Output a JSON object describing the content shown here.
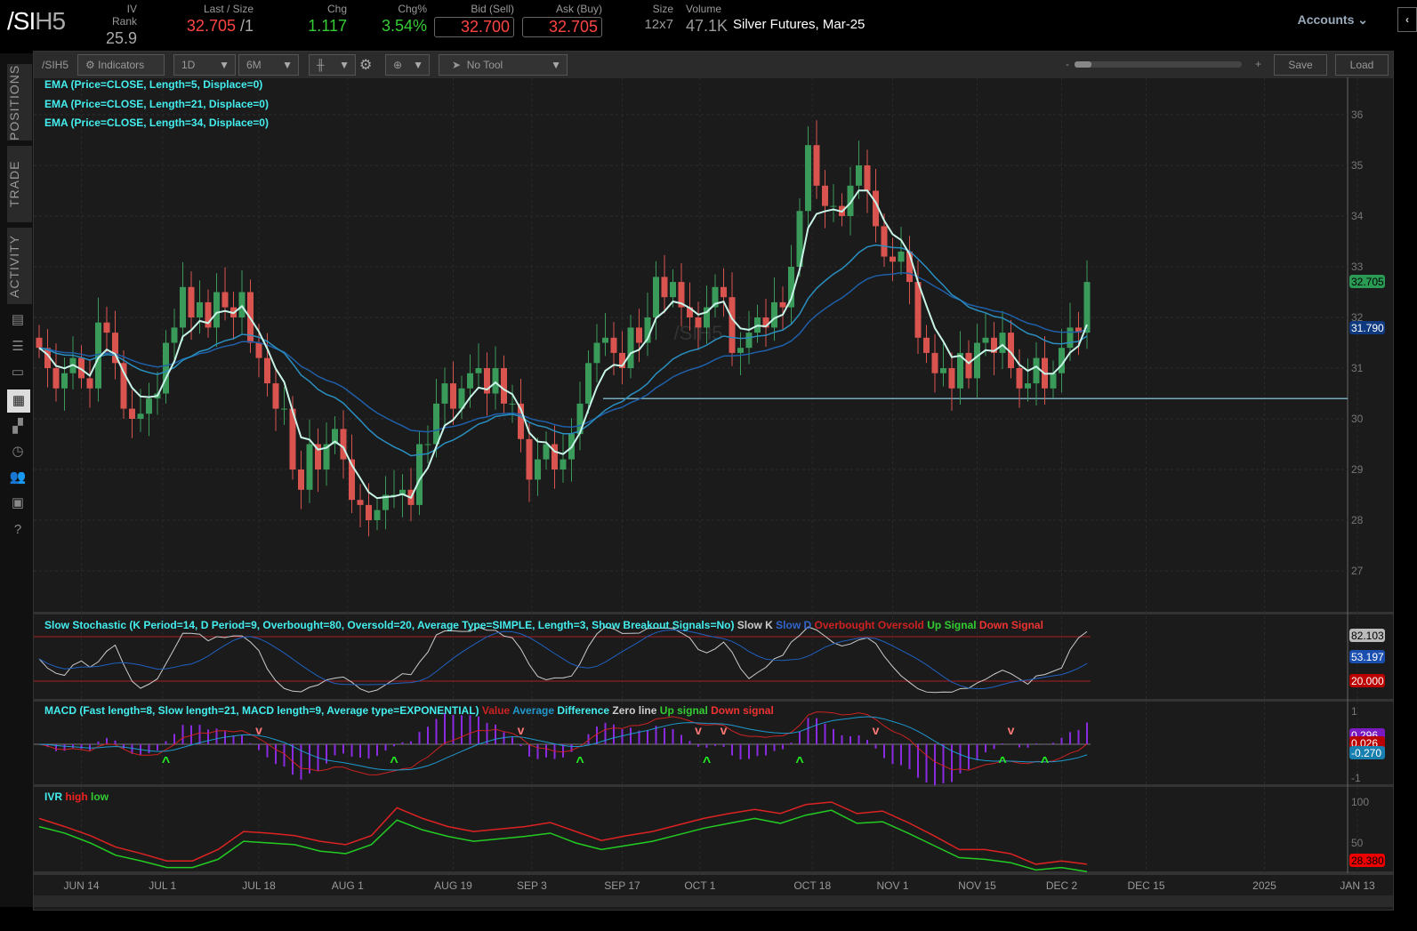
{
  "header": {
    "symbol_root": "/SI",
    "symbol_suffix": "H5",
    "quotes": [
      {
        "label": "IV Rank",
        "value": "25.9"
      },
      {
        "label": "Last / Size",
        "value": "32.705",
        "size": " /1"
      },
      {
        "label": "Chg",
        "value": "1.117"
      },
      {
        "label": "Chg%",
        "value": "3.54%"
      },
      {
        "label": "Bid (Sell)",
        "value": "32.700"
      },
      {
        "label": "Ask (Buy)",
        "value": "32.705"
      },
      {
        "label": "Size",
        "value": "12x7"
      },
      {
        "label": "Volume",
        "value": "47.1K"
      }
    ],
    "description": "Silver Futures, Mar-25",
    "accounts": "Accounts"
  },
  "sidebar": {
    "tabs": [
      "POSITIONS",
      "TRADE",
      "ACTIVITY"
    ],
    "icons": [
      "chart-report-icon",
      "list-icon",
      "tv-icon",
      "charts-icon",
      "grid-icon",
      "clock-icon",
      "community-icon",
      "calendar-icon",
      "help-icon"
    ]
  },
  "toolbar": {
    "symbol": "/SIH5",
    "indicators": "Indicators",
    "aggregation": "1D",
    "timeframe": "6M",
    "tool": "No Tool",
    "zoom_minus": "-",
    "zoom_plus": "+",
    "save": "Save",
    "load": "Load"
  },
  "studies": {
    "ema": [
      "EMA (Price=CLOSE, Length=5, Displace=0)",
      "EMA (Price=CLOSE, Length=21, Displace=0)",
      "EMA (Price=CLOSE, Length=34, Displace=0)"
    ],
    "stoch": {
      "title": "Slow Stochastic (K Period=14, D Period=9, Overbought=80, Oversold=20, Average Type=SIMPLE, Length=3, Show Breakout Signals=No)",
      "legend": [
        "Slow K",
        "Slow D",
        "Overbought",
        "Oversold",
        "Up Signal",
        "Down Signal"
      ],
      "k_label": "82.103",
      "d_label": "53.197",
      "os_label": "20.000",
      "ob": 80,
      "os": 20
    },
    "macd": {
      "title": "MACD (Fast length=8, Slow length=21, MACD length=9, Average type=EXPONENTIAL)",
      "legend": [
        "Value",
        "Average",
        "Difference",
        "Zero line",
        "Up signal",
        "Down signal"
      ],
      "labels": [
        "0.296",
        "0.026",
        "-0.270"
      ],
      "ticks": [
        "1",
        "-1"
      ],
      "up_signals": [
        15,
        42,
        64,
        79,
        90,
        114,
        119
      ],
      "down_signals": [
        26,
        57,
        78,
        81,
        99,
        115
      ]
    },
    "ivr": {
      "title": "IVR",
      "legend": [
        "high",
        "low"
      ],
      "label": "28.380",
      "ticks": [
        "100",
        "50"
      ],
      "high": [
        80,
        70,
        59,
        45,
        37,
        28,
        28,
        42,
        64,
        62,
        59,
        52,
        48,
        59,
        93,
        80,
        70,
        64,
        67,
        70,
        75,
        64,
        53,
        59,
        64,
        72,
        80,
        86,
        91,
        86,
        97,
        100,
        86,
        89,
        75,
        59,
        42,
        42,
        37,
        24,
        28,
        24
      ],
      "low": [
        70,
        62,
        50,
        35,
        28,
        20,
        20,
        30,
        52,
        50,
        48,
        40,
        37,
        48,
        78,
        66,
        58,
        52,
        55,
        58,
        62,
        50,
        42,
        47,
        52,
        60,
        68,
        74,
        80,
        74,
        84,
        90,
        74,
        76,
        62,
        47,
        32,
        30,
        26,
        17,
        20,
        15
      ]
    }
  },
  "price_axis": {
    "ticks": [
      "36",
      "35",
      "34",
      "33",
      "32",
      "31",
      "30",
      "29",
      "28",
      "27"
    ],
    "last_label": "32.705",
    "ema_label": "31.790",
    "support_level": 30.4,
    "watermark": "/SIH5"
  },
  "dates": [
    {
      "t": "JUN 14",
      "i": 5
    },
    {
      "t": "JUL 1",
      "i": 14.6
    },
    {
      "t": "JUL 18",
      "i": 26
    },
    {
      "t": "AUG 1",
      "i": 36.5
    },
    {
      "t": "AUG 19",
      "i": 49
    },
    {
      "t": "SEP 3",
      "i": 58.3
    },
    {
      "t": "SEP 17",
      "i": 69
    },
    {
      "t": "OCT 1",
      "i": 78.2
    },
    {
      "t": "OCT 18",
      "i": 91.5
    },
    {
      "t": "NOV 1",
      "i": 101
    },
    {
      "t": "NOV 15",
      "i": 111
    },
    {
      "t": "DEC 2",
      "i": 121
    },
    {
      "t": "DEC 15",
      "i": 131
    },
    {
      "t": "2025",
      "i": 145
    },
    {
      "t": "JAN 13",
      "i": 156
    }
  ],
  "colors": {
    "up": "#3a9a5a",
    "down": "#d9534f",
    "ema5": "#c8f5e8",
    "ema21": "#2a8fc0",
    "ema34": "#1f5fa8",
    "stochK": "#cccccc",
    "stochD": "#2060c0",
    "macdVal": "#cc2222",
    "macdAvg": "#1e9ad0",
    "macdDiff": "#8a2be2"
  },
  "closes": [
    31.4,
    31.0,
    30.6,
    30.9,
    31.2,
    30.8,
    30.6,
    31.9,
    31.7,
    31.1,
    30.2,
    30.0,
    30.1,
    30.4,
    30.5,
    31.5,
    31.8,
    32.6,
    32.0,
    32.3,
    31.8,
    32.5,
    32.2,
    32.0,
    32.5,
    31.5,
    31.2,
    30.7,
    30.2,
    30.2,
    29.0,
    28.6,
    29.5,
    29.0,
    29.5,
    29.8,
    29.2,
    28.4,
    28.3,
    28.0,
    28.2,
    28.5,
    28.5,
    28.6,
    28.3,
    29.5,
    29.5,
    30.3,
    30.7,
    30.2,
    30.6,
    30.9,
    31.0,
    30.5,
    31.0,
    30.3,
    30.3,
    29.6,
    28.8,
    29.2,
    29.5,
    29.0,
    29.2,
    29.7,
    30.3,
    31.1,
    31.5,
    31.6,
    31.3,
    31.0,
    31.8,
    31.5,
    32.0,
    32.8,
    32.4,
    32.7,
    32.2,
    32.0,
    31.8,
    32.2,
    32.6,
    32.4,
    31.3,
    31.4,
    31.7,
    32.0,
    31.8,
    32.3,
    32.2,
    33.0,
    34.1,
    35.4,
    34.6,
    34.2,
    34.2,
    34.0,
    34.6,
    35.0,
    34.5,
    33.8,
    33.2,
    33.1,
    33.3,
    32.7,
    31.6,
    31.3,
    30.9,
    31.0,
    30.6,
    31.3,
    30.8,
    31.5,
    31.6,
    31.3,
    31.7,
    31.0,
    30.6,
    30.7,
    31.2,
    30.6,
    30.9,
    31.4,
    31.8,
    31.7,
    32.7
  ]
}
